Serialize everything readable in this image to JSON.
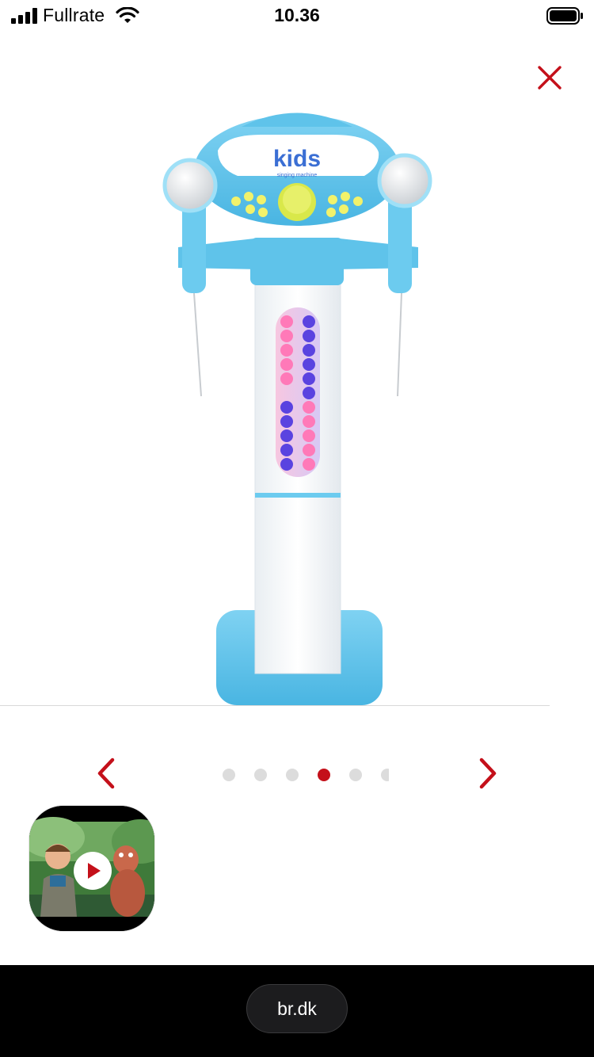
{
  "status_bar": {
    "carrier": "Fullrate",
    "time": "10.36"
  },
  "gallery": {
    "product_image": {
      "logo_text": "kids",
      "logo_subtext": "singing machine"
    },
    "current_slide_index": 3,
    "visible_dot_count": 6
  },
  "video_thumbnail": {
    "has_play_button": true
  },
  "browser": {
    "url_label": "br.dk"
  },
  "colors": {
    "accent": "#c4101a",
    "dot_inactive": "#dcdcdc",
    "product_blue": "#5fc3ea",
    "bottom_bar": "#000000"
  },
  "icons": {
    "close": "close-icon",
    "prev": "chevron-left-icon",
    "next": "chevron-right-icon",
    "play": "play-icon"
  }
}
